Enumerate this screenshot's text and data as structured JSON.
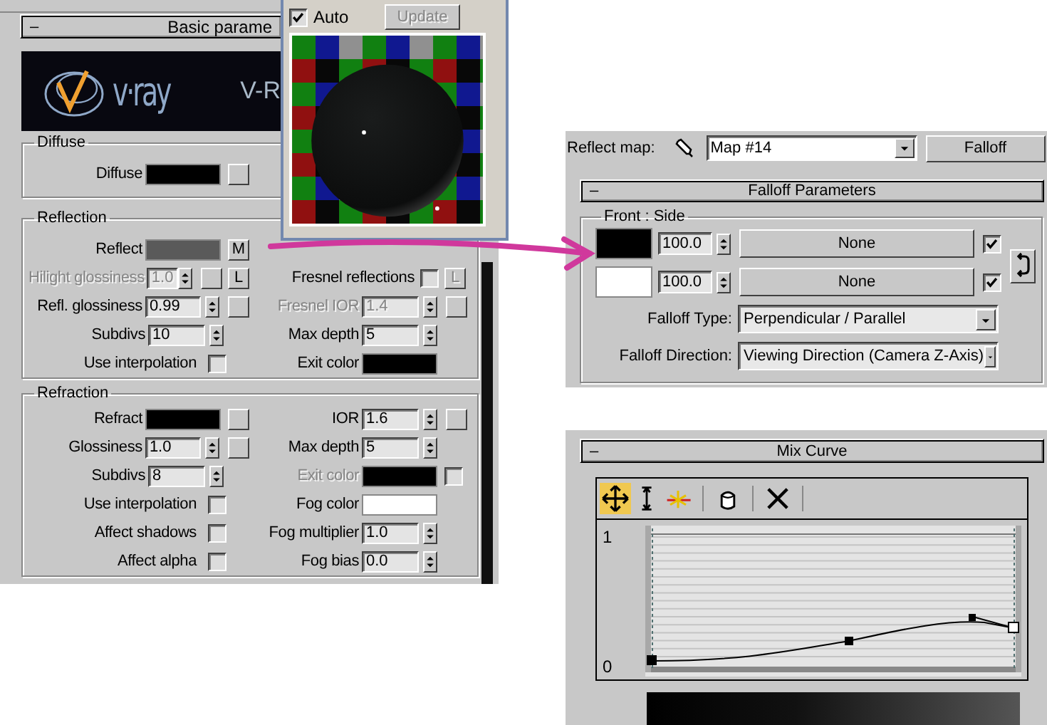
{
  "material_panel": {
    "rollout": {
      "sign": "–",
      "title": "Basic parame"
    },
    "logo": {
      "text": "v·ray",
      "caption": "V-R"
    },
    "groups": [
      {
        "title": "Diffuse",
        "rows": [
          {
            "left": {
              "label": "Diffuse",
              "kind": "swatch",
              "color": "#000000",
              "map_button": true
            }
          }
        ]
      },
      {
        "title": "Reflection",
        "rows": [
          {
            "left": {
              "label": "Reflect",
              "kind": "swatch",
              "color": "#5a5a5a",
              "map_button": true,
              "map_label": "M"
            }
          },
          {
            "left": {
              "label": "Hilight glossiness",
              "kind": "spinner",
              "value": "1.0",
              "disabled": true,
              "map_button": true,
              "lock_label": "L"
            },
            "right": {
              "label": "Fresnel reflections",
              "kind": "check",
              "checked": false,
              "lock_label": "L",
              "lock_disabled": true
            }
          },
          {
            "left": {
              "label": "Refl. glossiness",
              "kind": "spinner",
              "value": "0.99",
              "map_button": true
            },
            "right": {
              "label": "Fresnel IOR",
              "kind": "spinner",
              "value": "1.4",
              "disabled": true,
              "map_button": true
            }
          },
          {
            "left": {
              "label": "Subdivs",
              "kind": "spinner",
              "value": "10"
            },
            "right": {
              "label": "Max depth",
              "kind": "spinner",
              "value": "5"
            }
          },
          {
            "left": {
              "label": "Use interpolation",
              "kind": "check",
              "checked": false
            },
            "right": {
              "label": "Exit color",
              "kind": "swatch",
              "color": "#000000"
            }
          }
        ]
      },
      {
        "title": "Refraction",
        "rows": [
          {
            "left": {
              "label": "Refract",
              "kind": "swatch",
              "color": "#000000",
              "map_button": true
            },
            "right": {
              "label": "IOR",
              "kind": "spinner",
              "value": "1.6",
              "map_button": true
            }
          },
          {
            "left": {
              "label": "Glossiness",
              "kind": "spinner",
              "value": "1.0",
              "map_button": true
            },
            "right": {
              "label": "Max depth",
              "kind": "spinner",
              "value": "5"
            }
          },
          {
            "left": {
              "label": "Subdivs",
              "kind": "spinner",
              "value": "8"
            },
            "right": {
              "label": "Exit color",
              "kind": "swatch",
              "color": "#000000",
              "disabled": true,
              "checked": false
            }
          },
          {
            "left": {
              "label": "Use interpolation",
              "kind": "check",
              "checked": false
            },
            "right": {
              "label": "Fog color",
              "kind": "swatch",
              "color": "#ffffff"
            }
          },
          {
            "left": {
              "label": "Affect shadows",
              "kind": "check",
              "checked": false
            },
            "right": {
              "label": "Fog multiplier",
              "kind": "spinner",
              "value": "1.0"
            }
          },
          {
            "left": {
              "label": "Affect alpha",
              "kind": "check",
              "checked": false
            },
            "right": {
              "label": "Fog bias",
              "kind": "spinner",
              "value": "0.0"
            }
          }
        ]
      }
    ]
  },
  "preview": {
    "auto": {
      "label": "Auto",
      "checked": true
    },
    "update": {
      "label": "Update",
      "disabled": true
    }
  },
  "reflect_map": {
    "label": "Reflect map:",
    "map_name": "Map #14",
    "type_button": "Falloff"
  },
  "falloff": {
    "rollout": {
      "sign": "–",
      "title": "Falloff Parameters"
    },
    "group_title": "Front : Side",
    "slots": [
      {
        "color": "#000000",
        "amount": "100.0",
        "map": "None",
        "checked": true
      },
      {
        "color": "#ffffff",
        "amount": "100.0",
        "map": "None",
        "checked": true
      }
    ],
    "type": {
      "label": "Falloff Type:",
      "value": "Perpendicular / Parallel"
    },
    "direction": {
      "label": "Falloff Direction:",
      "value": "Viewing Direction (Camera Z-Axis)"
    }
  },
  "mix_curve": {
    "rollout": {
      "sign": "–",
      "title": "Mix Curve"
    },
    "toolbar": [
      {
        "tools": [
          {
            "kind": "move",
            "selected": true
          },
          {
            "kind": "scale",
            "selected": false
          },
          {
            "kind": "insert",
            "selected": false
          }
        ]
      },
      {
        "tools": [
          {
            "kind": "reset",
            "selected": false
          }
        ]
      },
      {
        "tools": [
          {
            "kind": "delete",
            "selected": false
          }
        ]
      }
    ],
    "y_max": "1",
    "y_min": "0"
  }
}
